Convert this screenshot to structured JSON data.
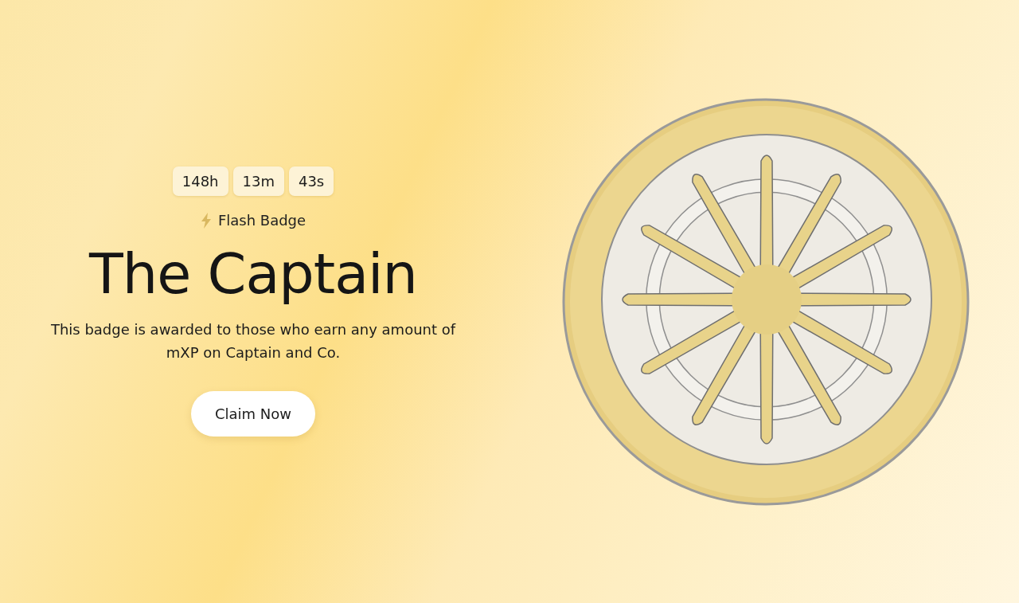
{
  "countdown": [
    "148h",
    "13m",
    "43s"
  ],
  "badge_type": "Flash Badge",
  "title": "The Captain",
  "description": "This badge is awarded to those who earn any amount of mXP on Captain and Co.",
  "button": "Claim Now"
}
